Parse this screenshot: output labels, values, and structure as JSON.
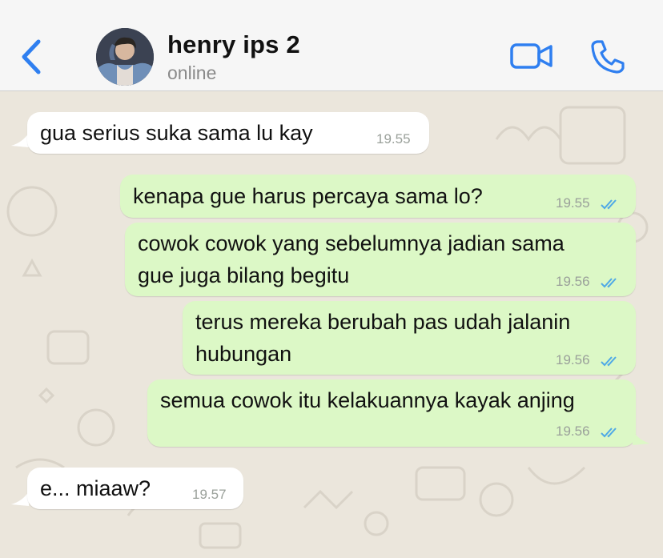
{
  "header": {
    "contact_name": "henry ips 2",
    "status": "online"
  },
  "messages": [
    {
      "direction": "incoming",
      "text": "gua serius suka sama lu kay",
      "time": "19.55"
    },
    {
      "direction": "outgoing",
      "text": "kenapa gue harus percaya sama lo?",
      "time": "19.55",
      "read": true
    },
    {
      "direction": "outgoing",
      "lines": [
        "cowok cowok yang sebelumnya jadian sama",
        "gue juga bilang begitu"
      ],
      "time": "19.56",
      "read": true
    },
    {
      "direction": "outgoing",
      "lines": [
        "terus mereka berubah pas udah jalanin",
        "hubungan"
      ],
      "time": "19.56",
      "read": true
    },
    {
      "direction": "outgoing",
      "text": "semua cowok itu kelakuannya kayak anjing",
      "time": "19.56",
      "read": true
    },
    {
      "direction": "incoming",
      "text": "e... miaaw?",
      "time": "19.57"
    }
  ],
  "colors": {
    "accent": "#2f7ff0",
    "incoming_bubble": "#ffffff",
    "outgoing_bubble": "#dcf8c6",
    "read_ticks": "#4fa9e6",
    "chat_background": "#ebe6dc"
  },
  "icons": {
    "back": "chevron-left-icon",
    "video": "video-camera-icon",
    "call": "phone-icon"
  }
}
